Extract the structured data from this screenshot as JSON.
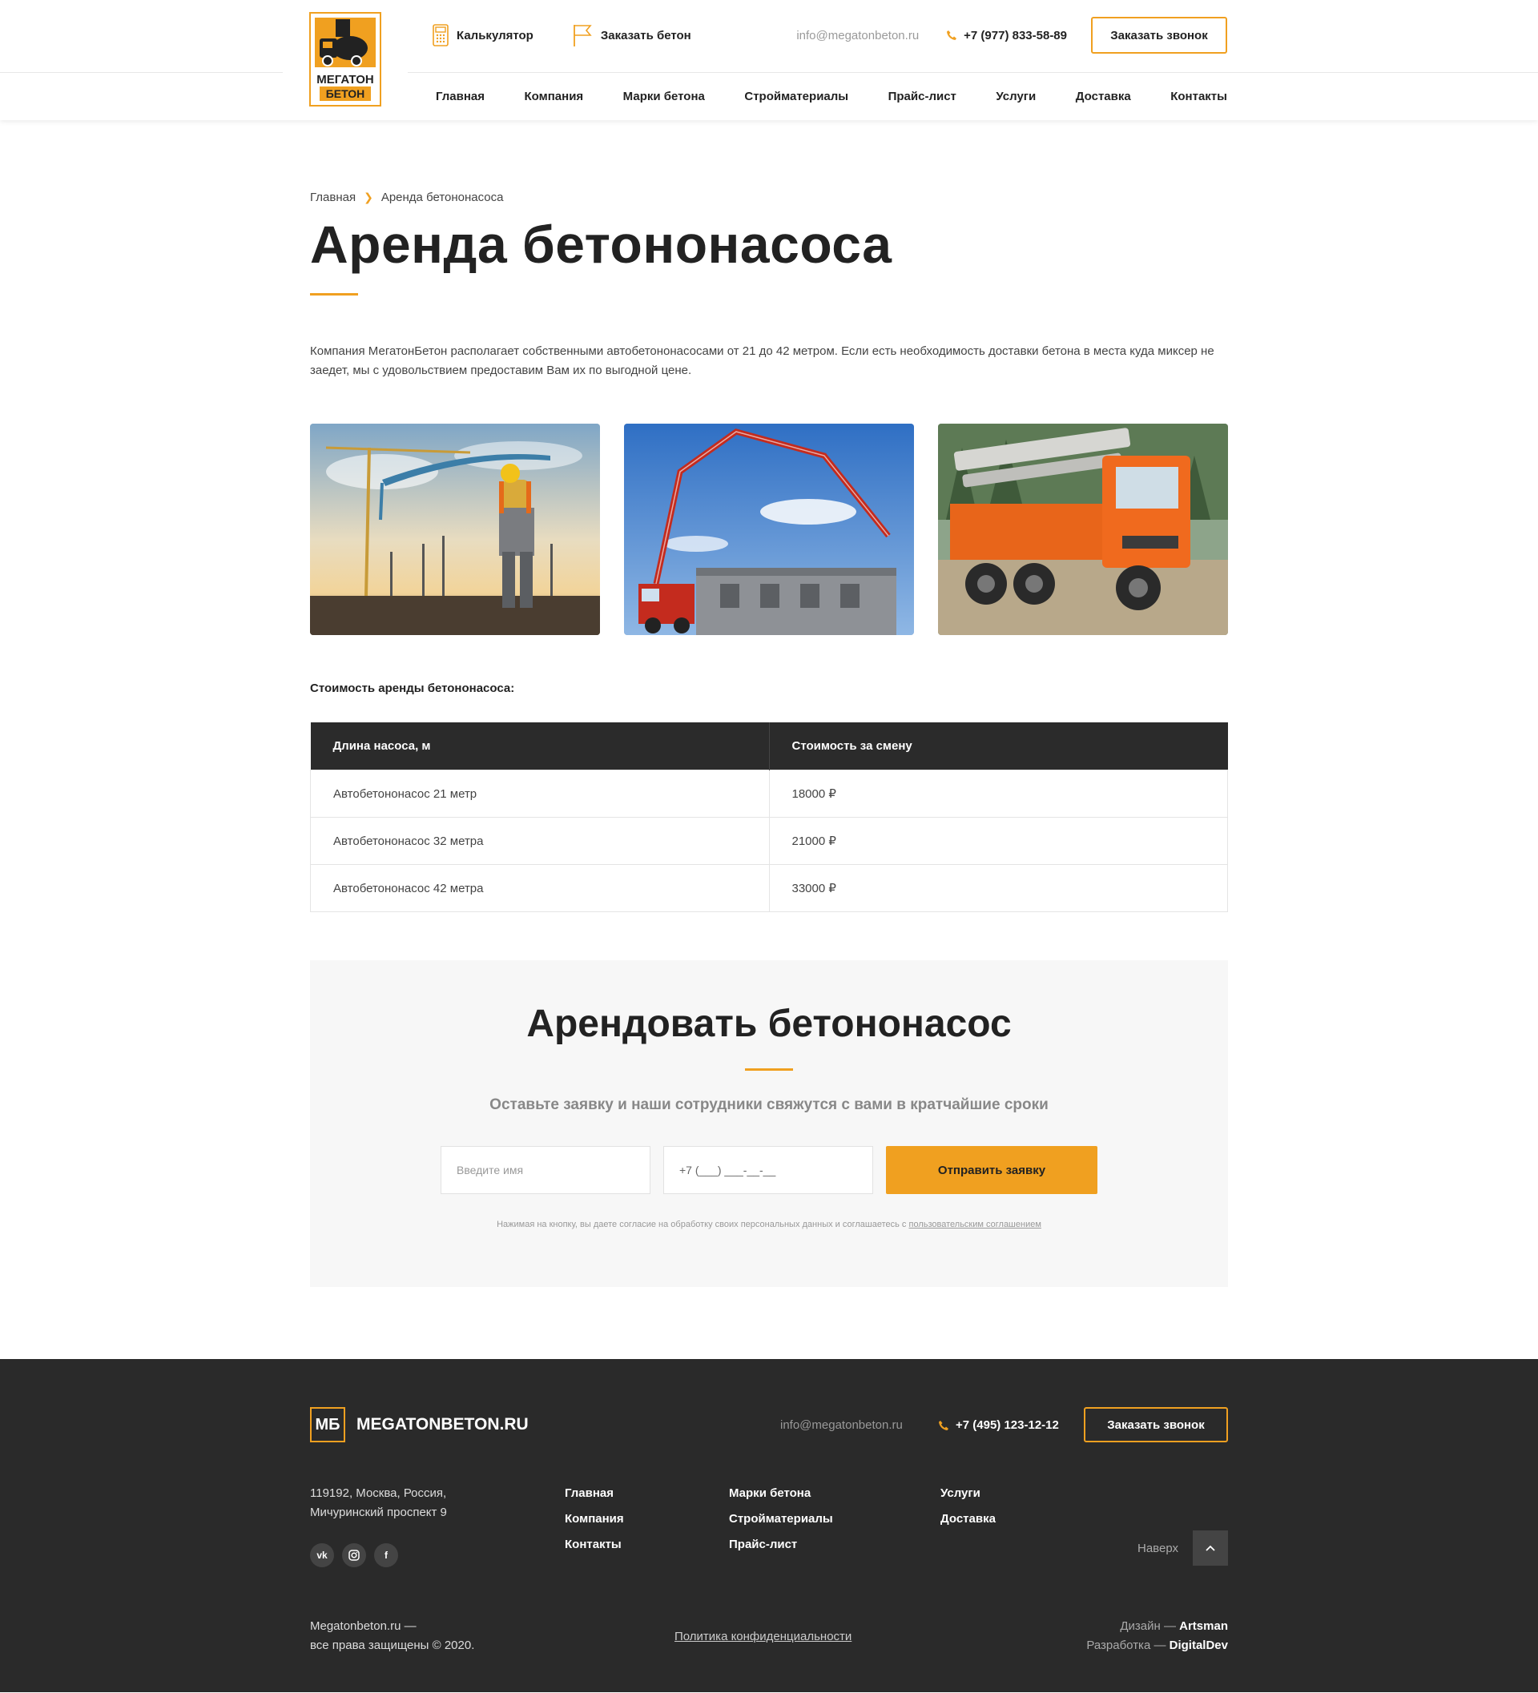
{
  "brand": {
    "logo_line1": "МЕГАТОН",
    "logo_line2": "БЕТОН",
    "accent_color": "#f0a020",
    "dark_color": "#2b2b2b"
  },
  "header": {
    "calculator_label": "Калькулятор",
    "order_concrete_label": "Заказать бетон",
    "email": "info@megatonbeton.ru",
    "phone": "+7 (977) 833-58-89",
    "callback_button": "Заказать звонок",
    "nav": [
      "Главная",
      "Компания",
      "Марки бетона",
      "Стройматериалы",
      "Прайс-лист",
      "Услуги",
      "Доставка",
      "Контакты"
    ]
  },
  "breadcrumb": {
    "home": "Главная",
    "current": "Аренда бетононасоса"
  },
  "page": {
    "title": "Аренда бетононасоса",
    "intro": "Компания МегатонБетон располагает собственными автобетононасосами от 21 до 42 метром. Если есть необходимость доставки бетона в места куда миксер не заедет, мы с удовольствием предоставим Вам их по выгодной цене.",
    "table_caption": "Стоимость аренды бетононасоса:"
  },
  "price_table": {
    "headers": [
      "Длина насоса, м",
      "Стоимость за смену"
    ],
    "rows": [
      [
        "Автобетононасос 21 метр",
        "18000 ₽"
      ],
      [
        "Автобетононасос 32 метра",
        "21000 ₽"
      ],
      [
        "Автобетононасос 42 метра",
        "33000 ₽"
      ]
    ]
  },
  "form": {
    "title": "Арендовать бетононасос",
    "subtitle": "Оставьте заявку и наши сотрудники свяжутся с вами в кратчайшие сроки",
    "name_placeholder": "Введите имя",
    "phone_placeholder": "+7 (___) ___-__-__",
    "submit": "Отправить заявку",
    "note": "Нажимая на кнопку, вы даете согласие на обработку своих персональных данных и соглашаетесь с",
    "note_link": "пользовательским соглашением"
  },
  "footer": {
    "logo_mark": "МБ",
    "logo_text": "MEGATONBETON.RU",
    "email": "info@megatonbeton.ru",
    "phone": "+7 (495) 123-12-12",
    "callback_button": "Заказать звонок",
    "address_line1": "119192, Москва, Россия,",
    "address_line2": "Мичуринский проспект 9",
    "social": [
      "vk",
      "instagram",
      "facebook"
    ],
    "col1": [
      "Главная",
      "Компания",
      "Контакты"
    ],
    "col2": [
      "Марки бетона",
      "Стройматериалы",
      "Прайс-лист"
    ],
    "col3": [
      "Услуги",
      "Доставка"
    ],
    "to_top": "Наверх",
    "copy_line1": "Megatonbeton.ru —",
    "copy_line2": "все права защищены © 2020.",
    "policy": "Политика конфиденциальности",
    "design_label": "Дизайн —",
    "design_by": "Artsman",
    "dev_label": "Разработка —",
    "dev_by": "DigitalDev"
  }
}
